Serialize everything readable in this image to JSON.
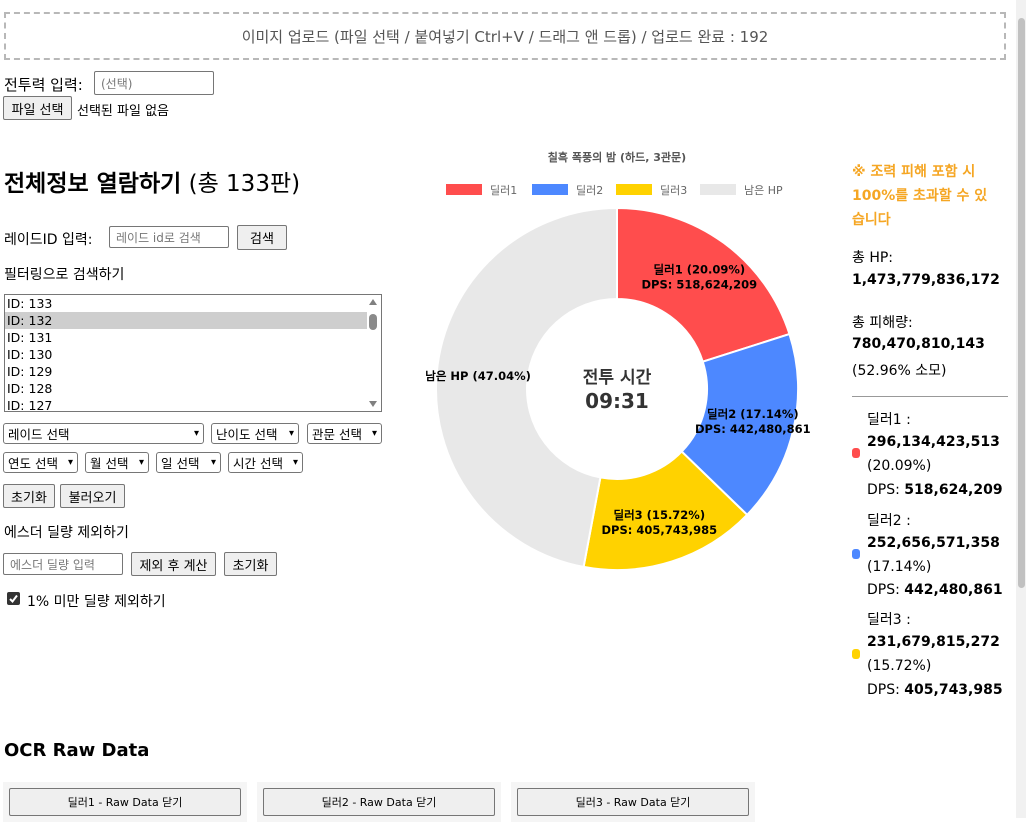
{
  "upload": {
    "text": "이미지 업로드 (파일 선택 / 붙여넣기 Ctrl+V / 드래그 앤 드롭) / 업로드 완료 : 192"
  },
  "power": {
    "label": "전투력 입력:",
    "placeholder": "(선택)"
  },
  "file": {
    "button": "파일 선택",
    "status": "선택된 파일 없음"
  },
  "main": {
    "title": "전체정보 열람하기",
    "count": "(총 133판)"
  },
  "raid_search": {
    "label": "레이드ID 입력:",
    "placeholder": "레이드 id로 검색",
    "button": "검색"
  },
  "filter": {
    "label": "필터링으로 검색하기",
    "ids": [
      "ID: 133",
      "ID: 132",
      "ID: 131",
      "ID: 130",
      "ID: 129",
      "ID: 128",
      "ID: 127"
    ],
    "selected_index": 1,
    "selects": {
      "raid": "레이드 선택",
      "difficulty": "난이도 선택",
      "gate": "관문 선택",
      "year": "연도 선택",
      "month": "월 선택",
      "day": "일 선택",
      "time": "시간 선택"
    },
    "reset": "초기화",
    "load": "불러오기"
  },
  "esther": {
    "label": "에스더 딜량 제외하기",
    "placeholder": "에스더 딜량 입력",
    "calc": "제외 후 계산",
    "reset": "초기화",
    "exclude_small": "1% 미만 딜량 제외하기",
    "exclude_small_checked": true
  },
  "chart_data": {
    "type": "pie",
    "title": "칠흑 폭풍의 밤 (하드, 3관문)",
    "center_label": "전투 시간",
    "center_value": "09:31",
    "legend_position": "top",
    "categories": [
      "딜러1",
      "딜러2",
      "딜러3",
      "남은 HP"
    ],
    "values": [
      20.09,
      17.14,
      15.72,
      47.04
    ],
    "colors": [
      "#ff4d4d",
      "#4d88ff",
      "#ffd200",
      "#e8e8e8"
    ],
    "slice_labels": [
      {
        "name": "딜러1 (20.09%)",
        "dps": "DPS: 518,624,209"
      },
      {
        "name": "딜러2 (17.14%)",
        "dps": "DPS: 442,480,861"
      },
      {
        "name": "딜러3 (15.72%)",
        "dps": "DPS: 405,743,985"
      },
      {
        "name": "남은 HP (47.04%)",
        "dps": ""
      }
    ]
  },
  "summary": {
    "warning": [
      "※ 조력 피해 포함 시",
      "100%를 초과할 수 있",
      "습니다"
    ],
    "total_hp_label": "총 HP:",
    "total_hp": "1,473,779,836,172",
    "total_damage_label": "총 피해량:",
    "total_damage": "780,470,810,143",
    "consumed": "(52.96% 소모)",
    "dealers": [
      {
        "name": "딜러1 :",
        "damage": "296,134,423,513",
        "pct": "(20.09%)",
        "dps_label": "DPS:",
        "dps": "518,624,209",
        "color": "#ff4d4d"
      },
      {
        "name": "딜러2 :",
        "damage": "252,656,571,358",
        "pct": "(17.14%)",
        "dps_label": "DPS:",
        "dps": "442,480,861",
        "color": "#4d88ff"
      },
      {
        "name": "딜러3 :",
        "damage": "231,679,815,272",
        "pct": "(15.72%)",
        "dps_label": "DPS:",
        "dps": "405,743,985",
        "color": "#ffd200"
      }
    ]
  },
  "ocr": {
    "title": "OCR Raw Data",
    "buttons": [
      "딜러1 - Raw Data 닫기",
      "딜러2 - Raw Data 닫기",
      "딜러3 - Raw Data 닫기"
    ]
  }
}
